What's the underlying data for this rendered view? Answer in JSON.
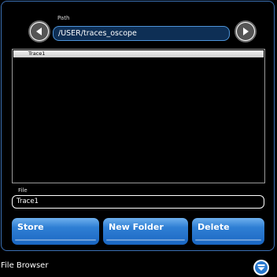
{
  "path": {
    "label": "Path",
    "value": "/USER/traces_oscope"
  },
  "file_list": {
    "items": [
      {
        "label": "Trace1"
      }
    ]
  },
  "file": {
    "label": "File",
    "value": "Trace1"
  },
  "actions": {
    "store_label": "Store",
    "new_folder_label": "New Folder",
    "delete_label": "Delete"
  },
  "footer": {
    "title": "File Browser"
  },
  "icons": {
    "back": "back-arrow-icon",
    "forward": "forward-arrow-icon",
    "menu": "chevron-down-icon"
  },
  "colors": {
    "accent": "#2f7fd4",
    "field_border": "#4e94d8",
    "frame_border": "#3b6fb3"
  }
}
